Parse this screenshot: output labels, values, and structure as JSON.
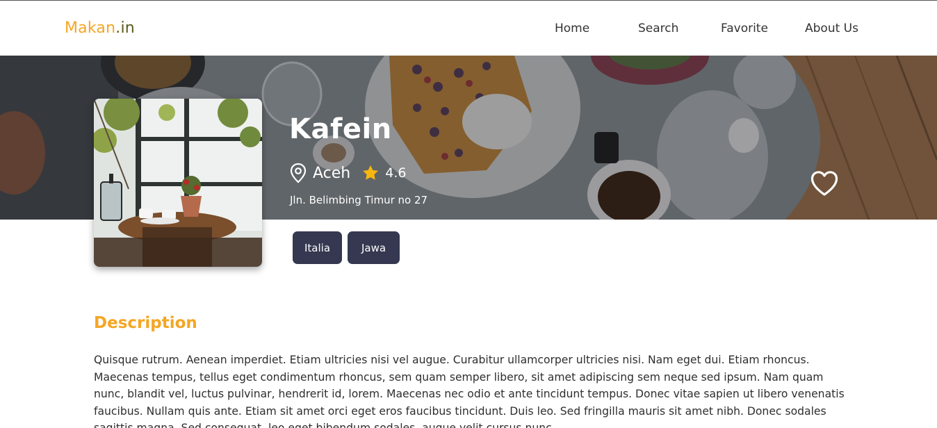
{
  "header": {
    "brand_primary": "Makan",
    "brand_secondary": ".in",
    "nav": [
      "Home",
      "Search",
      "Favorite",
      "About Us"
    ]
  },
  "restaurant": {
    "name": "Kafein",
    "city": "Aceh",
    "rating": "4.6",
    "address": "Jln. Belimbing Timur no 27",
    "categories": [
      "Italia",
      "Jawa"
    ]
  },
  "description": {
    "heading": "Description",
    "text": "Quisque rutrum. Aenean imperdiet. Etiam ultricies nisi vel augue. Curabitur ullamcorper ultricies nisi. Nam eget dui. Etiam rhoncus. Maecenas tempus, tellus eget condimentum rhoncus, sem quam semper libero, sit amet adipiscing sem neque sed ipsum. Nam quam nunc, blandit vel, luctus pulvinar, hendrerit id, lorem. Maecenas nec odio et ante tincidunt tempus. Donec vitae sapien ut libero venenatis faucibus. Nullam quis ante. Etiam sit amet orci eget eros faucibus tincidunt. Duis leo. Sed fringilla mauris sit amet nibh. Donec sodales sagittis magna. Sed consequat, leo eget bibendum sodales, augue velit cursus nunc,"
  },
  "icons": {
    "location": "map-pin-icon",
    "rating": "star-icon",
    "favorite": "heart-outline-icon"
  },
  "colors": {
    "brand_accent": "#f5a623",
    "brand_secondary": "#5a5a1a",
    "tag_background": "#353850",
    "star": "#f8b70e"
  }
}
